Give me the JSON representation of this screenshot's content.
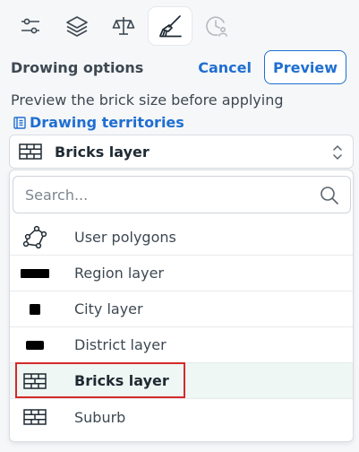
{
  "toolbar": {
    "tools": [
      {
        "icon": "sliders-icon",
        "active": false
      },
      {
        "icon": "layers-icon",
        "active": false
      },
      {
        "icon": "scales-icon",
        "active": false
      },
      {
        "icon": "brush-icon",
        "active": true
      },
      {
        "icon": "clock-user-icon",
        "active": false,
        "disabled": true
      }
    ]
  },
  "header": {
    "title": "Drowing options",
    "cancel_label": "Cancel",
    "preview_label": "Preview"
  },
  "description": "Preview the brick size before applying",
  "link": {
    "label": "Drawing territories",
    "icon": "document-icon"
  },
  "select": {
    "value": "Bricks layer",
    "icon": "brick-icon"
  },
  "dropdown": {
    "search_placeholder": "Search...",
    "items": [
      {
        "label": "User polygons",
        "icon": "polygon-icon"
      },
      {
        "label": "Region layer",
        "icon": "region-rect-icon"
      },
      {
        "label": "City layer",
        "icon": "city-square-icon"
      },
      {
        "label": "District layer",
        "icon": "district-rect-icon"
      },
      {
        "label": "Bricks layer",
        "icon": "brick-icon",
        "selected": true
      },
      {
        "label": "Suburb",
        "icon": "brick-icon"
      }
    ]
  },
  "colors": {
    "accent": "#1f6fd1",
    "selected_bg": "#eef7f3",
    "highlight": "#d42a2a"
  }
}
